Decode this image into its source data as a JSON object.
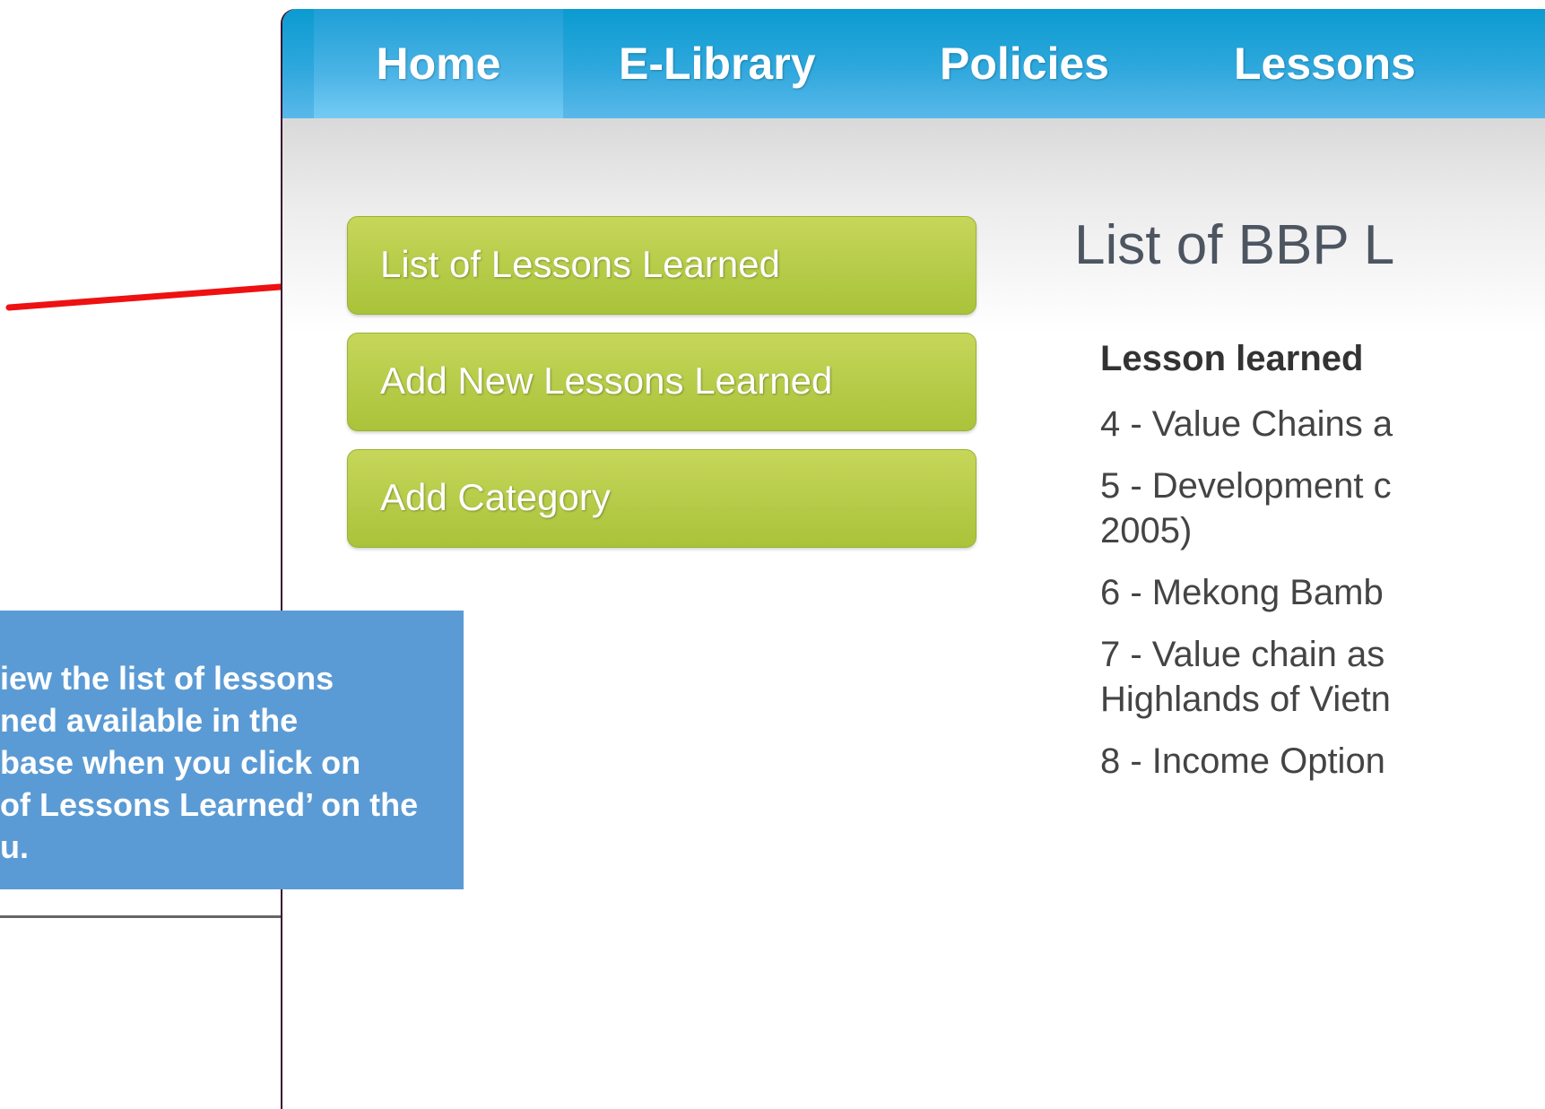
{
  "nav": {
    "items": [
      {
        "label": "Home"
      },
      {
        "label": "E-Library"
      },
      {
        "label": "Policies"
      },
      {
        "label": "Lessons"
      }
    ]
  },
  "sidebar": {
    "buttons": [
      {
        "label": "List of Lessons Learned"
      },
      {
        "label": "Add New Lessons Learned"
      },
      {
        "label": "Add Category"
      }
    ]
  },
  "main": {
    "title": "List of BBP L",
    "column_header": "Lesson learned",
    "lessons": [
      {
        "line1": "4 - Value Chains a"
      },
      {
        "line1": "5 - Development c",
        "line2": "2005)"
      },
      {
        "line1": "6 - Mekong Bamb"
      },
      {
        "line1": "7 - Value chain as",
        "line2": "Highlands of Vietn"
      },
      {
        "line1": "8 - Income Option"
      }
    ]
  },
  "callout": {
    "lines": [
      "iew the list of lessons",
      "ned available in the",
      "base when you click on",
      "of Lessons Learned’ on the",
      "u."
    ]
  },
  "colors": {
    "nav_blue": "#2fa8dd",
    "button_green": "#b5ca45",
    "callout_blue": "#5b9bd5",
    "arrow_red": "#ee1111"
  }
}
